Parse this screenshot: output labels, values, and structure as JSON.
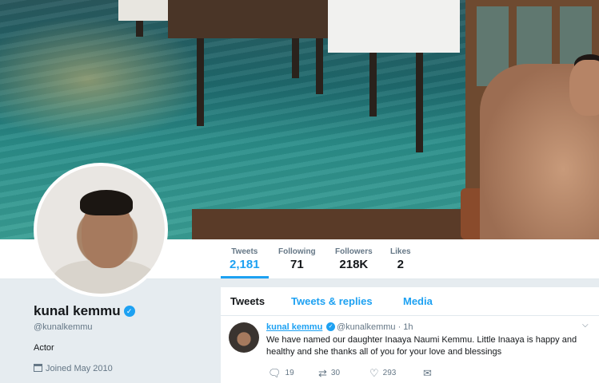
{
  "profile": {
    "name": "kunal kemmu",
    "handle": "@kunalkemmu",
    "bio": "Actor",
    "joined": "Joined May 2010"
  },
  "stats": [
    {
      "label": "Tweets",
      "value": "2,181"
    },
    {
      "label": "Following",
      "value": "71"
    },
    {
      "label": "Followers",
      "value": "218K"
    },
    {
      "label": "Likes",
      "value": "2"
    }
  ],
  "tabs": [
    "Tweets",
    "Tweets & replies",
    "Media"
  ],
  "tweet": {
    "name": "kunal kemmu",
    "handle": "@kunalkemmu · 1h",
    "text": "We have named our daughter  Inaaya Naumi Kemmu. Little  Inaaya is happy and healthy and she thanks all of you for your love and blessings",
    "replies": "19",
    "retweets": "30",
    "likes": "293"
  },
  "icons": {
    "verified": "verified-badge",
    "calendar": "calendar-icon",
    "reply": "reply-icon",
    "retweet": "retweet-icon",
    "like": "heart-icon",
    "message": "direct-message-icon",
    "caret": "chevron-down-icon"
  },
  "colors": {
    "accent": "#1da1f2",
    "text": "#14171a",
    "muted": "#657786"
  }
}
